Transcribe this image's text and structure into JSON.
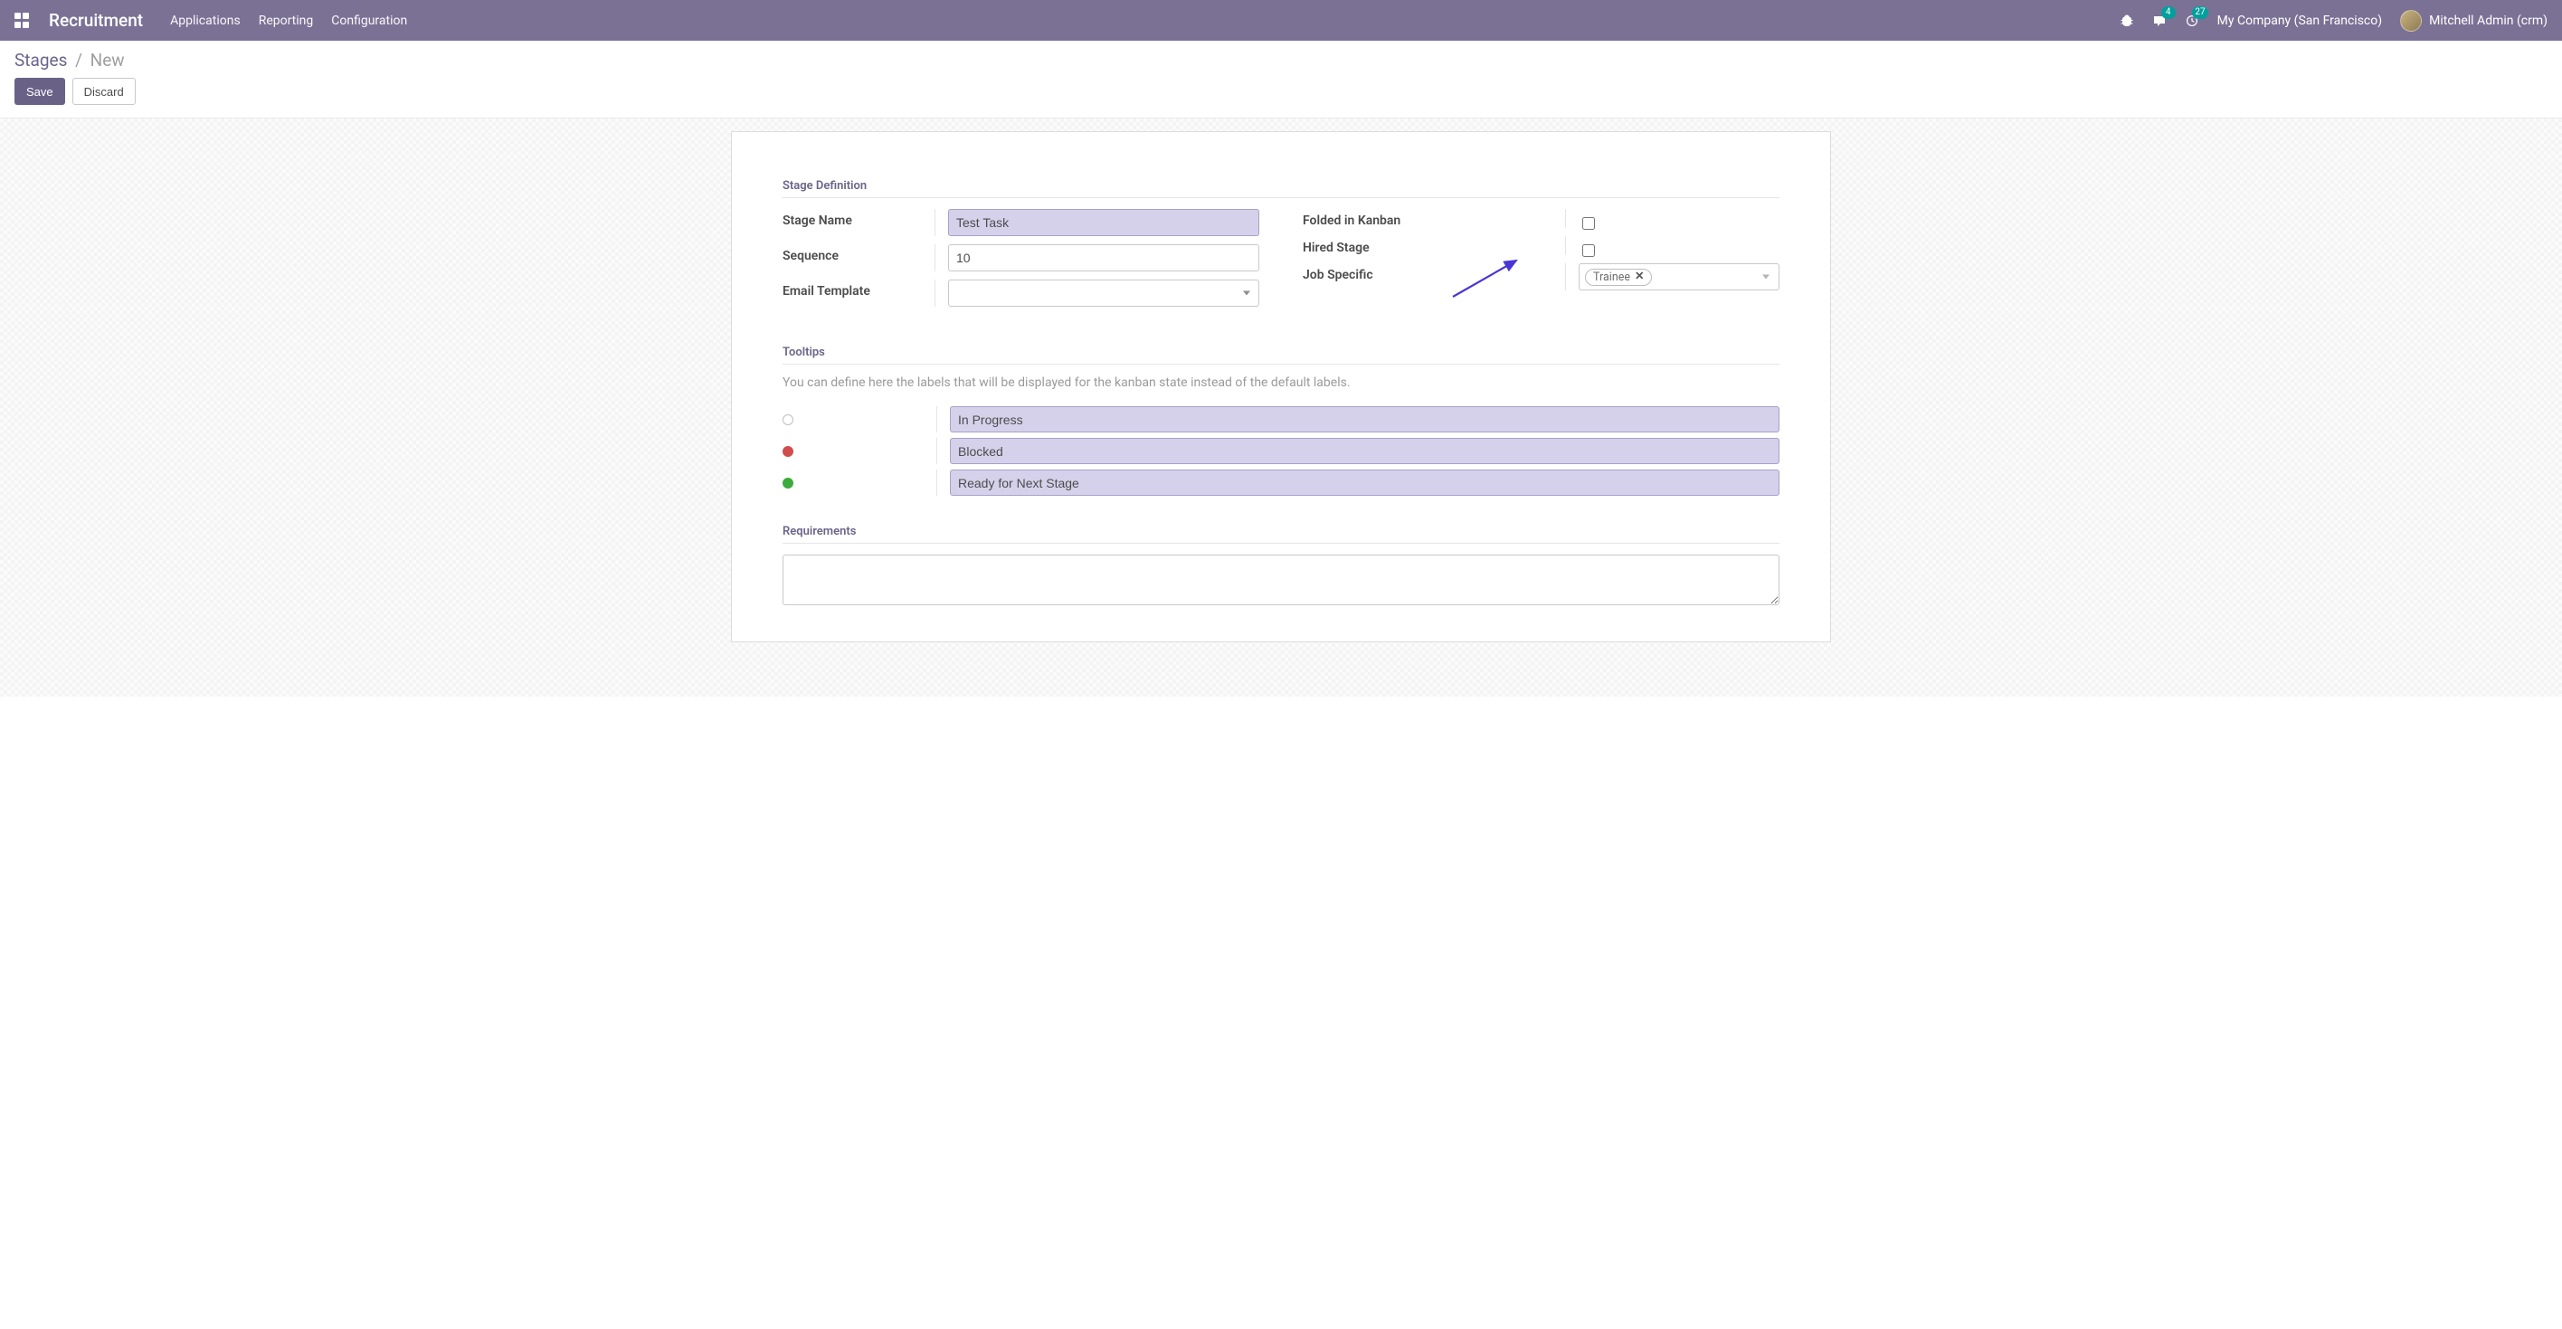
{
  "header": {
    "brand": "Recruitment",
    "nav": [
      "Applications",
      "Reporting",
      "Configuration"
    ],
    "messages_count": "4",
    "activities_count": "27",
    "company": "My Company (San Francisco)",
    "user": "Mitchell Admin (crm)"
  },
  "breadcrumb": {
    "parent": "Stages",
    "current": "New"
  },
  "buttons": {
    "save": "Save",
    "discard": "Discard"
  },
  "sections": {
    "stage_def": "Stage Definition",
    "tooltips": "Tooltips",
    "requirements": "Requirements"
  },
  "fields": {
    "stage_name_label": "Stage Name",
    "stage_name_value": "Test Task",
    "sequence_label": "Sequence",
    "sequence_value": "10",
    "email_template_label": "Email Template",
    "email_template_value": "",
    "folded_label": "Folded in Kanban",
    "folded_checked": false,
    "hired_label": "Hired Stage",
    "hired_checked": false,
    "job_specific_label": "Job Specific",
    "job_specific_tag": "Trainee"
  },
  "tooltips": {
    "help": "You can define here the labels that will be displayed for the kanban state instead of the default labels.",
    "normal": "In Progress",
    "blocked": "Blocked",
    "done": "Ready for Next Stage"
  },
  "requirements_value": ""
}
